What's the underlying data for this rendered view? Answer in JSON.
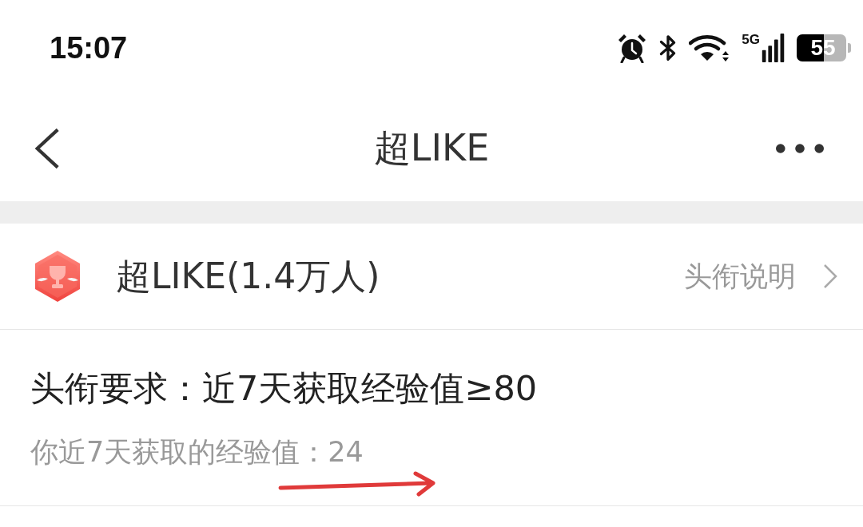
{
  "status_bar": {
    "time": "15:07",
    "network": "5G",
    "battery": "55"
  },
  "nav": {
    "title": "超LIKE"
  },
  "title_card": {
    "name": "超LIKE(1.4万人)",
    "link": "头衔说明"
  },
  "requirement": {
    "text": "头衔要求：近7天获取经验值≥80",
    "progress": "你近7天获取的经验值：24"
  }
}
